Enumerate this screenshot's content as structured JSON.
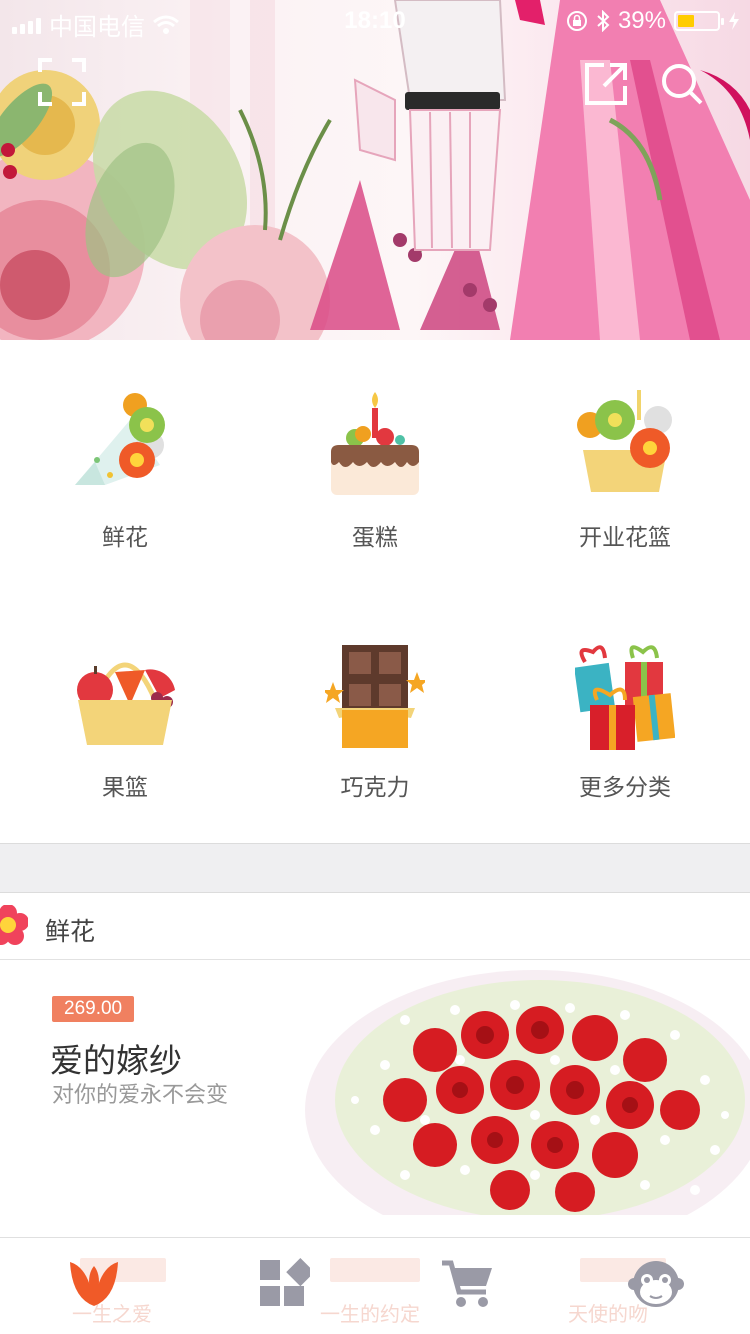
{
  "status_bar": {
    "carrier": "中国电信",
    "time": "18:10",
    "battery": "39%"
  },
  "banner": {
    "scan_icon": "scan-icon",
    "share_icon": "share-icon",
    "search_icon": "search-icon"
  },
  "categories": [
    {
      "label": "鲜花",
      "icon": "flower-bouquet-icon"
    },
    {
      "label": "蛋糕",
      "icon": "cake-icon"
    },
    {
      "label": "开业花篮",
      "icon": "flower-basket-icon"
    },
    {
      "label": "果篮",
      "icon": "fruit-basket-icon"
    },
    {
      "label": "巧克力",
      "icon": "chocolate-icon"
    },
    {
      "label": "更多分类",
      "icon": "gift-boxes-icon"
    }
  ],
  "section": {
    "title": "鲜花",
    "icon": "flower-icon"
  },
  "product": {
    "price": "269.00",
    "name": "爱的嫁纱",
    "description": "对你的爱永不会变"
  },
  "tab_bar": {
    "tabs": [
      {
        "icon": "home-petal-icon",
        "active": true
      },
      {
        "icon": "category-grid-icon",
        "active": false
      },
      {
        "icon": "cart-icon",
        "active": false
      },
      {
        "icon": "profile-monkey-icon",
        "active": false
      }
    ],
    "ghost_labels": [
      "一生之爱",
      "一生的约定",
      "天使的吻"
    ]
  },
  "colors": {
    "accent": "#f05a28",
    "price_badge": "#f08060",
    "tab_inactive": "#9a9aa6",
    "band": "#efeff1"
  }
}
